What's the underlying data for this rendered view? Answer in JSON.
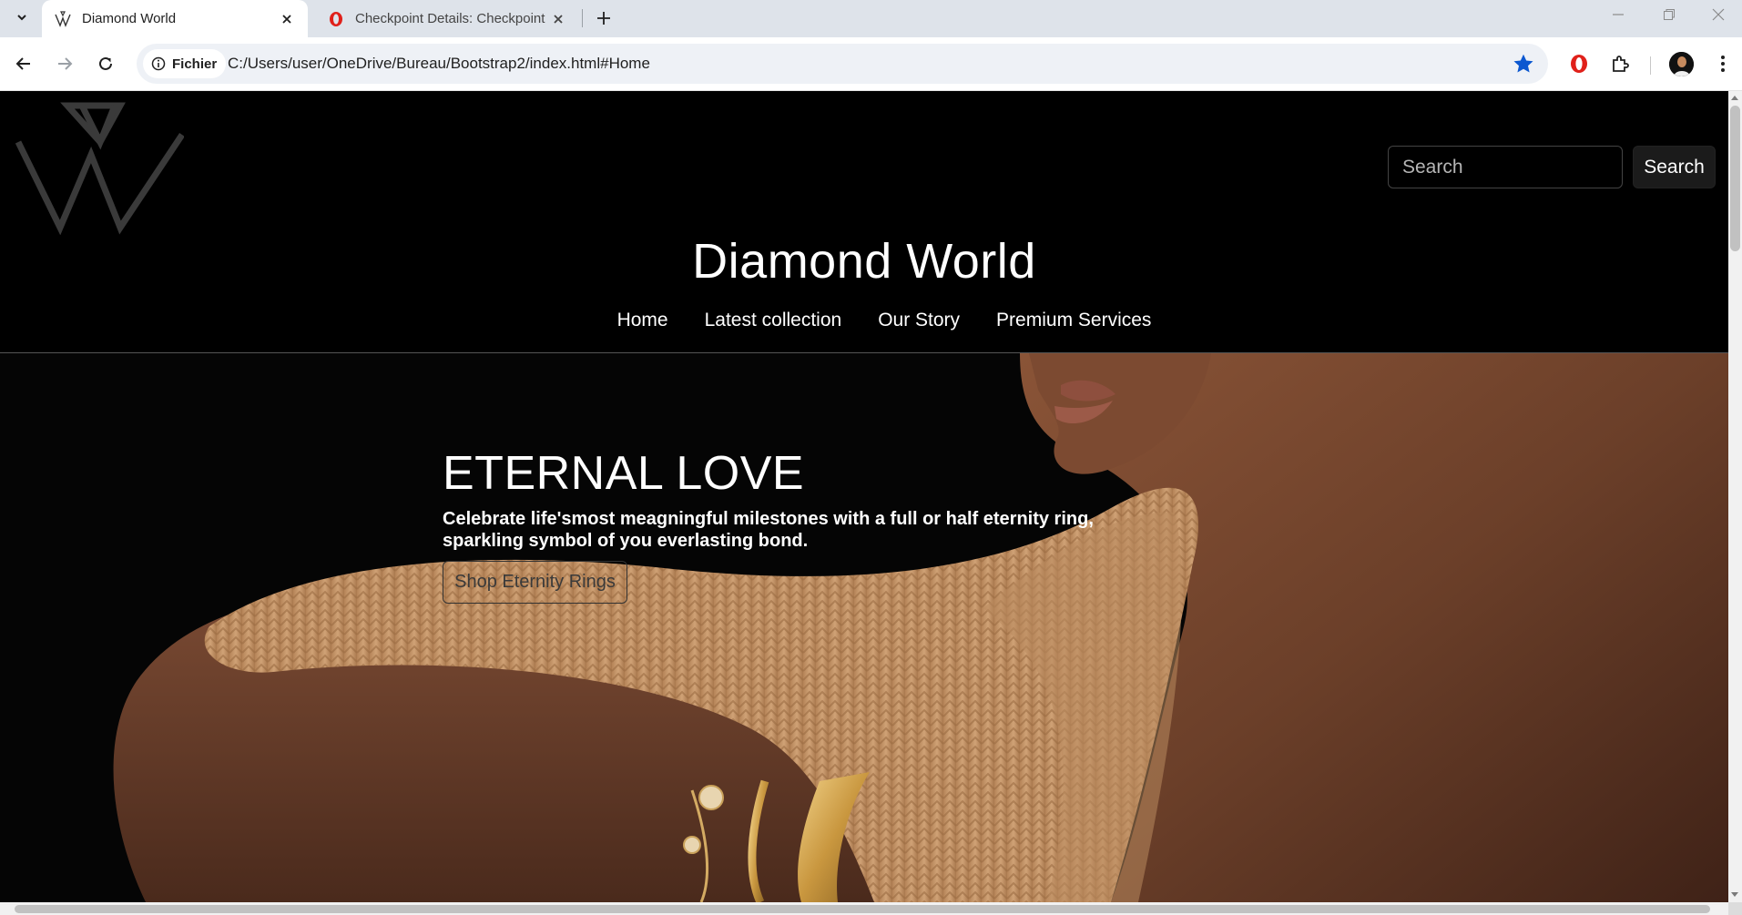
{
  "browser": {
    "tabs": [
      {
        "title": "Diamond World",
        "favicon": "diamond-world-logo-icon",
        "active": true
      },
      {
        "title": "Checkpoint Details: Checkpoint",
        "favicon": "opera-icon",
        "active": false
      }
    ],
    "address": {
      "site_chip": "Fichier",
      "url": "C:/Users/user/OneDrive/Bureau/Bootstrap2/index.html#Home"
    },
    "accent_color": "#0b57d0"
  },
  "site": {
    "brand": "Diamond World",
    "search": {
      "placeholder": "Search",
      "button_label": "Search"
    },
    "nav": {
      "home": "Home",
      "latest": "Latest collection",
      "story": "Our Story",
      "premium": "Premium Services"
    },
    "hero": {
      "title": "ETERNAL LOVE",
      "subtitle": "Celebrate life'smost meagningful milestones with a full or half eternity ring, sparkling symbol of you everlasting bond.",
      "button_label": "Shop Eternity Rings"
    },
    "colors": {
      "background": "#000000",
      "text": "#ffffff",
      "knit": "#c99a6e",
      "skin": "#6b3f29"
    }
  }
}
